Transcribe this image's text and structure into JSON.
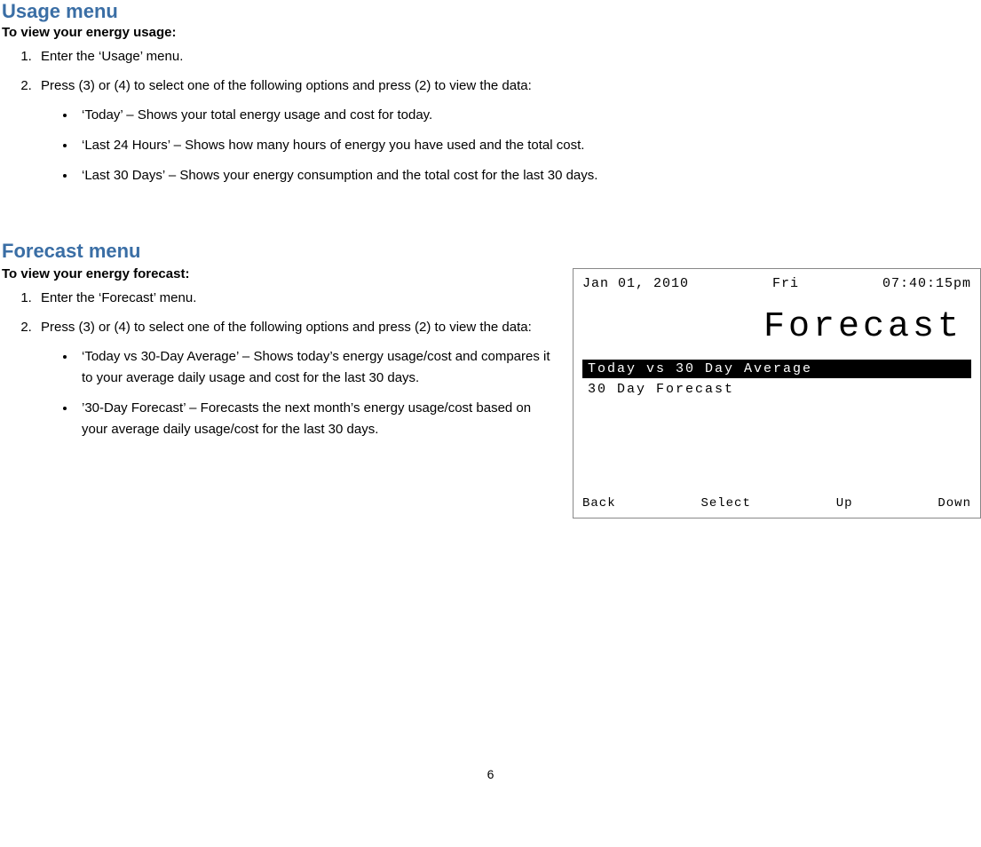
{
  "usage": {
    "heading": "Usage menu",
    "subhead": "To view your energy usage:",
    "step1": "Enter the ‘Usage’ menu.",
    "step2": "Press (3) or (4) to select one of the following options and press (2) to view the data:",
    "opt1": "‘Today’ – Shows your total energy usage and cost for today.",
    "opt2": "‘Last 24 Hours’ – Shows how many hours of energy you have used and the total cost.",
    "opt3": "‘Last 30 Days’ – Shows your energy consumption and the total cost for the last 30 days."
  },
  "forecast": {
    "heading": "Forecast menu",
    "subhead": "To view your energy forecast:",
    "step1": "Enter the ‘Forecast’ menu.",
    "step2": "Press (3) or (4) to select one of the following options and press (2) to view the data:",
    "opt1": "‘Today vs 30-Day Average’ – Shows today’s energy usage/cost and compares it to your average daily usage and cost for the last 30 days.",
    "opt2": "’30-Day Forecast’ – Forecasts the next month’s energy usage/cost based on your average daily usage/cost for the last 30 days."
  },
  "device": {
    "date": "Jan 01, 2010",
    "day": "Fri",
    "time": "07:40:15pm",
    "title": "Forecast",
    "menu1": "Today vs 30 Day Average",
    "menu2": "30 Day Forecast",
    "key1": "Back",
    "key2": "Select",
    "key3": "Up",
    "key4": "Down"
  },
  "page_number": "6"
}
